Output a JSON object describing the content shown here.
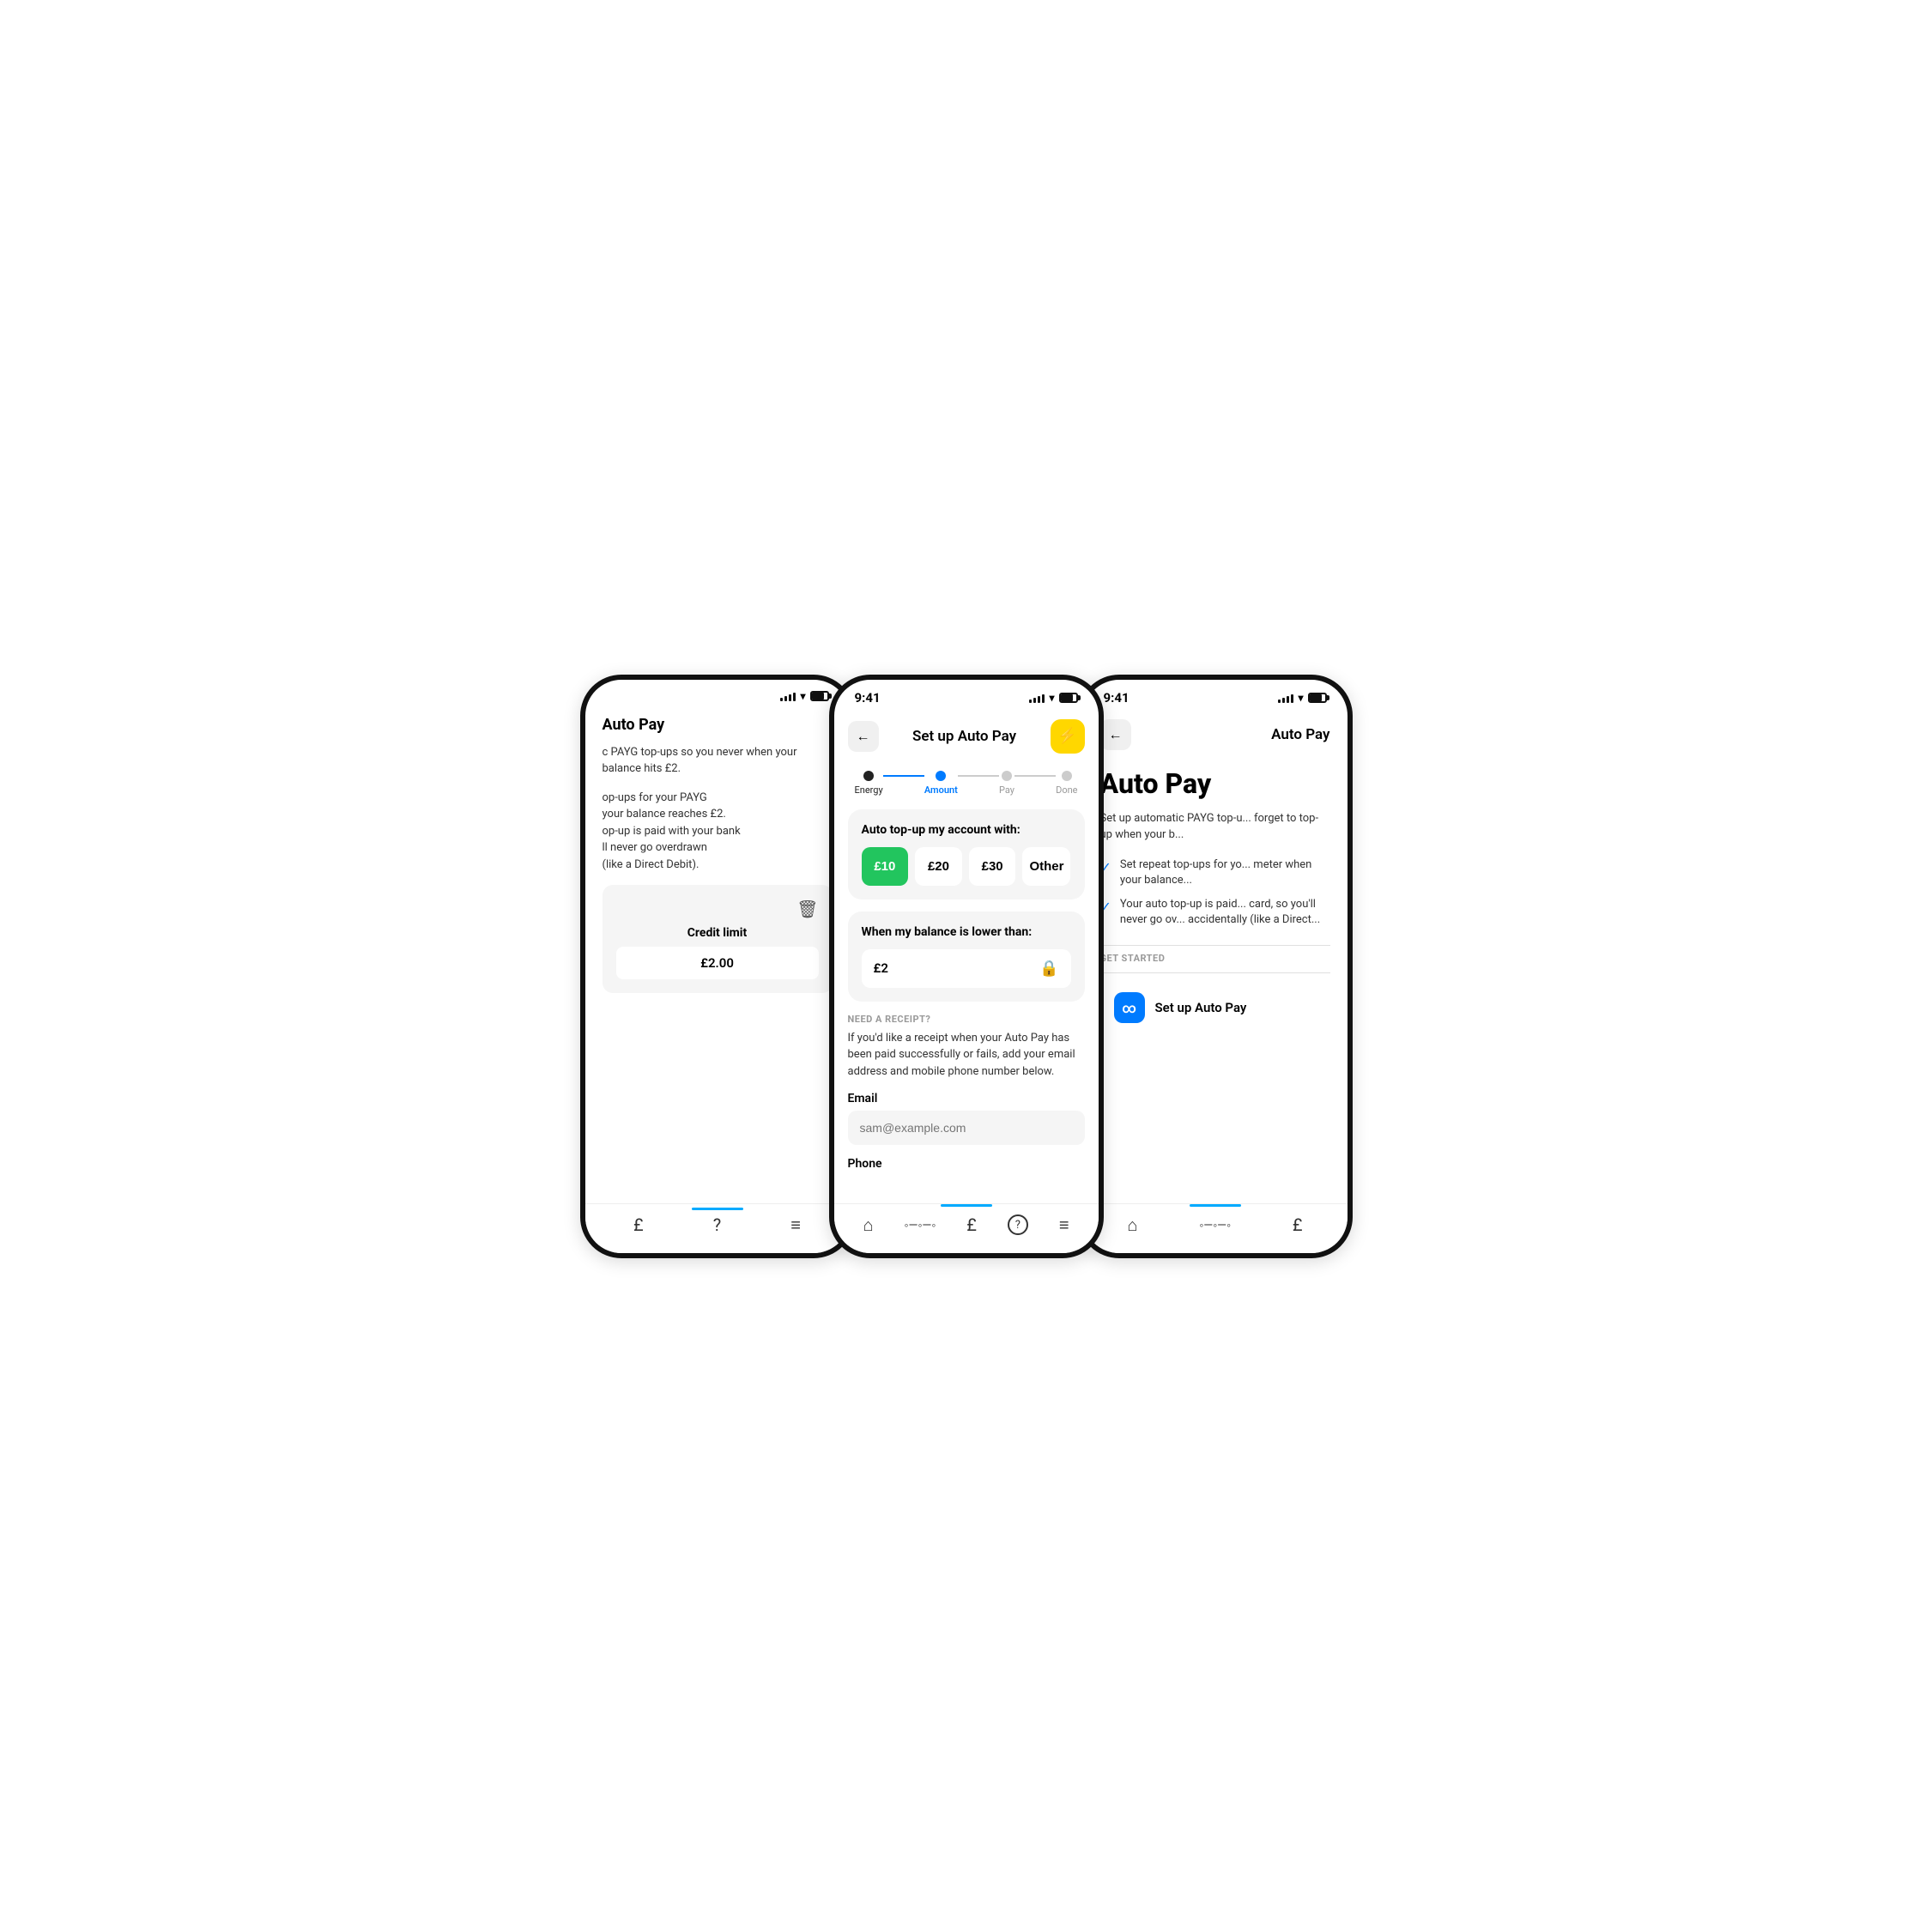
{
  "phones": {
    "left": {
      "title": "Auto Pay",
      "description": "c PAYG top-ups so you never when your balance hits £2.",
      "features": "op-ups for your PAYG\nyour balance reaches £2.\nop-up is paid with your bank\nll never go overdrawn\n(like a Direct Debit).",
      "credit_limit_label": "Credit limit",
      "credit_limit_value": "£2.00",
      "delete_icon": "🗑"
    },
    "center": {
      "time": "9:41",
      "title": "Set up Auto Pay",
      "back_label": "←",
      "lightning": "⚡",
      "steps": [
        {
          "label": "Energy",
          "state": "done"
        },
        {
          "label": "Amount",
          "state": "active"
        },
        {
          "label": "Pay",
          "state": "inactive"
        },
        {
          "label": "Done",
          "state": "inactive"
        }
      ],
      "topup_section": {
        "title": "Auto top-up my account with:",
        "options": [
          {
            "value": "£10",
            "selected": true
          },
          {
            "value": "£20",
            "selected": false
          },
          {
            "value": "£30",
            "selected": false
          },
          {
            "value": "Other",
            "selected": false
          }
        ]
      },
      "balance_section": {
        "title": "When my balance is lower than:",
        "value": "£2"
      },
      "receipt_section": {
        "label": "NEED A RECEIPT?",
        "description": "If you'd like a receipt when your Auto Pay has been paid successfully or fails, add your email address and mobile phone number below.",
        "email_label": "Email",
        "email_placeholder": "sam@example.com",
        "phone_label": "Phone"
      },
      "nav_items": [
        "🏠",
        "◦◦◦",
        "£",
        "?",
        "≡"
      ]
    },
    "right": {
      "time": "9:41",
      "title": "Auto Pay",
      "back_label": "←",
      "heading": "Auto Pay",
      "description": "Set up automatic PAYG top-u... forget to top-up when your b...",
      "features": [
        "Set repeat top-ups for yo... meter when your balance...",
        "Your auto top-up is paid... card, so you'll never go ov... accidentally (like a Direct..."
      ],
      "get_started_label": "GET STARTED",
      "setup_btn_label": "Set up Auto Pay",
      "setup_btn_icon": "∞",
      "nav_items": [
        "🏠",
        "◦◦◦",
        "£"
      ]
    }
  }
}
